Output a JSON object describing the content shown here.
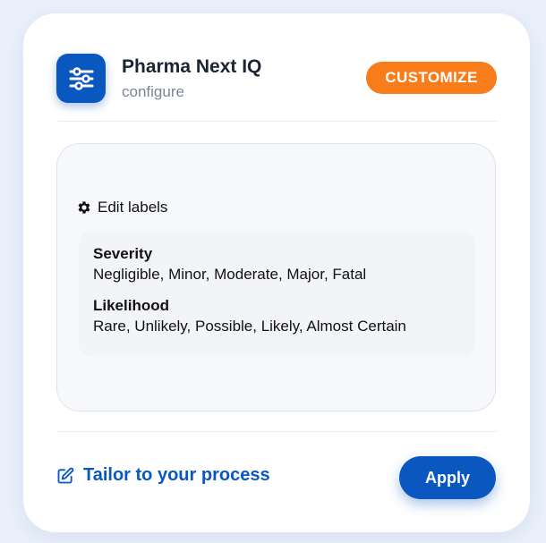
{
  "header": {
    "title": "Pharma Next IQ",
    "subtitle": "configure",
    "icon": "sliders-icon",
    "customize_label": "CUSTOMIZE"
  },
  "panel": {
    "edit_labels": "Edit labels",
    "edit_icon": "gear-icon",
    "groups": [
      {
        "title": "Severity",
        "values": "Negligible, Minor, Moderate, Major, Fatal"
      },
      {
        "title": "Likelihood",
        "values": "Rare, Unlikely, Possible, Likely, Almost Certain"
      }
    ]
  },
  "footer": {
    "link_label": "Tailor to your process",
    "link_icon": "pencil-square-icon",
    "apply_label": "Apply"
  },
  "colors": {
    "primary": "#0b57c0",
    "accent": "#f97c1b",
    "background": "#e9effb"
  }
}
